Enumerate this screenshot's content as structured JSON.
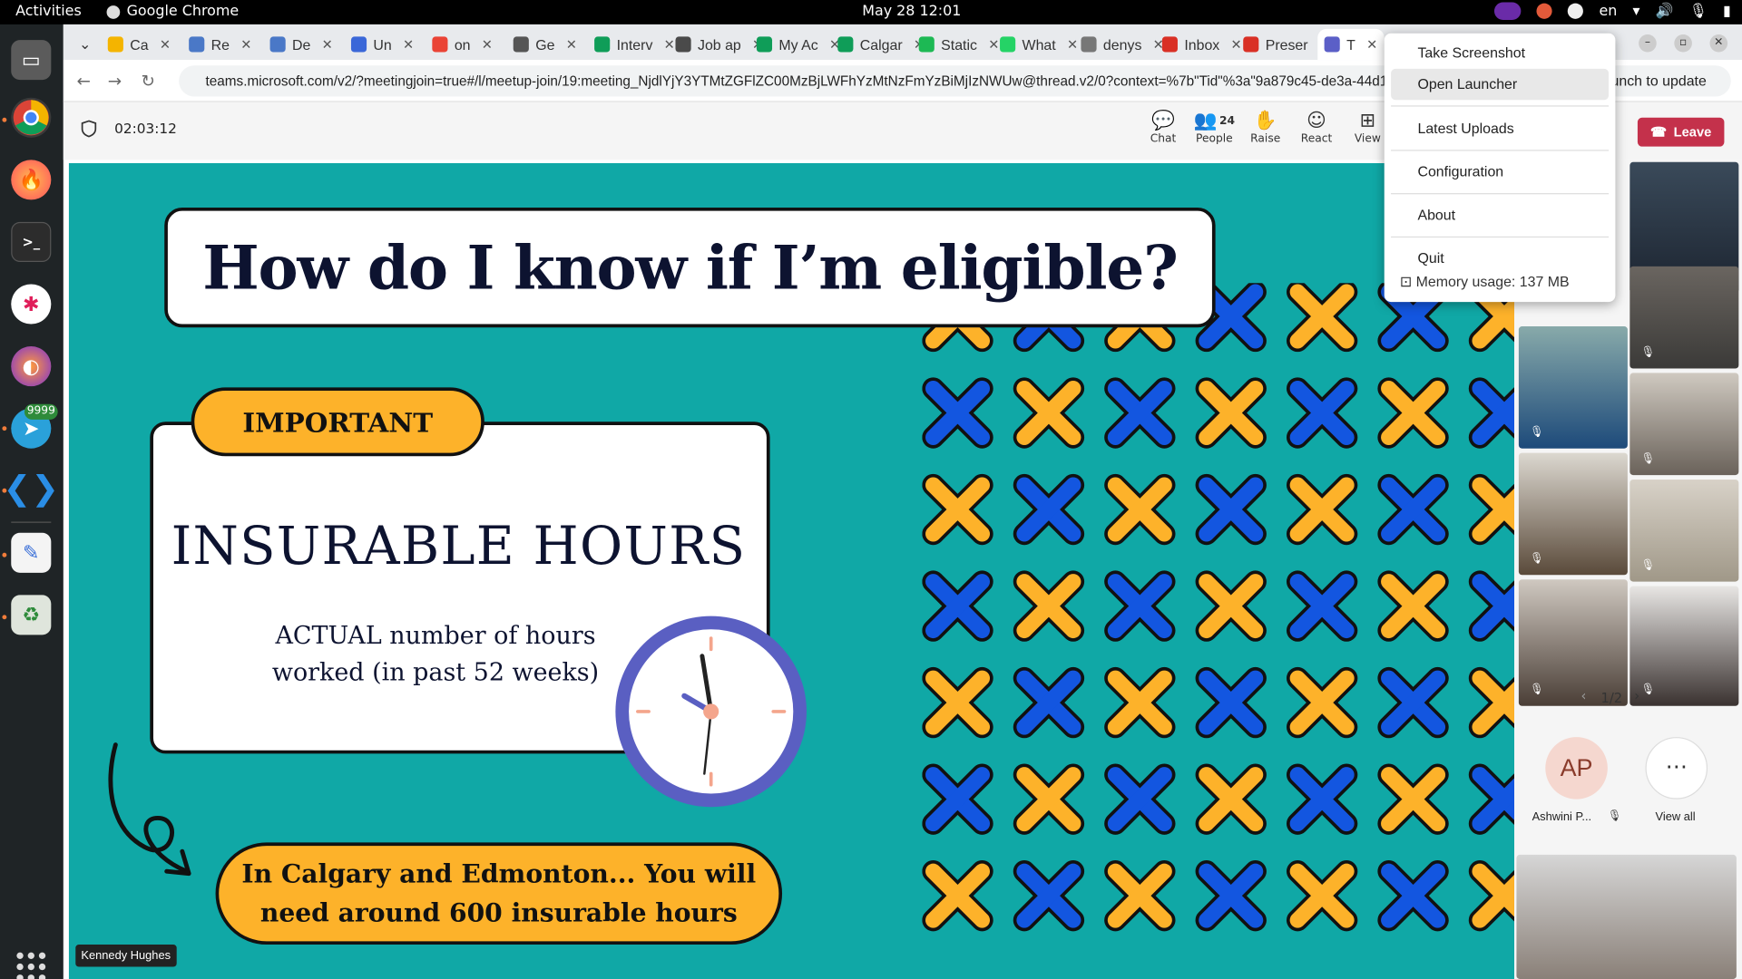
{
  "system": {
    "activities": "Activities",
    "app_name": "Google Chrome",
    "clock": "May 28  12:01",
    "lang": "en",
    "telegram_badge": "9999"
  },
  "tabs": [
    {
      "label": "Ca",
      "color": "#f4b400"
    },
    {
      "label": "Re",
      "color": "#4a78c7"
    },
    {
      "label": "De",
      "color": "#4a78c7"
    },
    {
      "label": "Un",
      "color": "#3a67d8"
    },
    {
      "label": "on",
      "color": "#ea4335"
    },
    {
      "label": "Ge",
      "color": "#555555"
    },
    {
      "label": "Interv",
      "color": "#0f9d58"
    },
    {
      "label": "Job ap",
      "color": "#4a4a4a"
    },
    {
      "label": "My Ac",
      "color": "#0f9d58"
    },
    {
      "label": "Calgar",
      "color": "#0f9d58"
    },
    {
      "label": "Static",
      "color": "#1db954"
    },
    {
      "label": "What",
      "color": "#25d366"
    },
    {
      "label": "denys",
      "color": "#777777"
    },
    {
      "label": "Inbox",
      "color": "#d93025"
    },
    {
      "label": "Preser",
      "color": "#d93025"
    },
    {
      "label": "T",
      "color": "#5b5fc7"
    }
  ],
  "address_bar": {
    "url": "teams.microsoft.com/v2/?meetingjoin=true#/l/meetup-join/19:meeting_NjdlYjY3YTMtZGFlZC00MzBjLWFhYzMtNzFmYzBiMjIzNWUw@thread.v2/0?context=%7b\"Tid\"%3a\"9a879c45-de3a-44d1-b30f-...",
    "relaunch": "Relaunch to update"
  },
  "meeting": {
    "timer": "02:03:12",
    "toolbar": [
      {
        "label": "Chat",
        "glyph": "💬"
      },
      {
        "label": "People",
        "glyph": "👥",
        "count": "24"
      },
      {
        "label": "Raise",
        "glyph": "✋"
      },
      {
        "label": "React",
        "glyph": "☺"
      },
      {
        "label": "View",
        "glyph": "⊞"
      }
    ],
    "leave": "Leave",
    "speaker_label": "Kennedy Hughes",
    "pagination": "1/2",
    "participant_initials": "AP",
    "participant_name": "Ashwini P...",
    "view_all": "View all"
  },
  "slide": {
    "title": "How do I know if I’m eligible?",
    "badge": "IMPORTANT",
    "heading": "INSURABLE HOURS",
    "subtext_line1": "ACTUAL number of hours",
    "subtext_line2": "worked (in past 52 weeks)",
    "bottom_line1": "In Calgary and Edmonton... You will",
    "bottom_line2": "need around 600 insurable hours",
    "colors": {
      "teal": "#10a8a6",
      "orange": "#fdb22a",
      "blue": "#1356e0"
    }
  },
  "context_menu": {
    "items": [
      "Take Screenshot",
      "Open Launcher",
      "Latest Uploads",
      "Configuration",
      "About",
      "Quit"
    ],
    "memory": "Memory usage: 137 MB"
  }
}
